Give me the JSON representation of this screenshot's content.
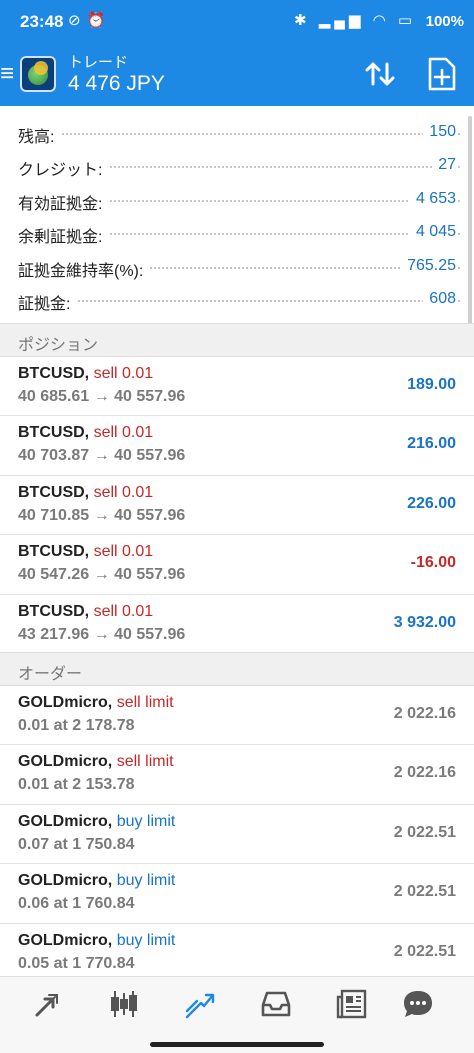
{
  "status_bar": {
    "time": "23:48",
    "battery": "100%"
  },
  "app_bar": {
    "title": "トレード",
    "subtitle": "4 476 JPY"
  },
  "summary": [
    {
      "label": "残高:",
      "value": "150"
    },
    {
      "label": "クレジット:",
      "value": "27"
    },
    {
      "label": "有効証拠金:",
      "value": "4 653"
    },
    {
      "label": "余剰証拠金:",
      "value": "4 045"
    },
    {
      "label": "証拠金維持率(%):",
      "value": "765.25"
    },
    {
      "label": "証拠金:",
      "value": "608"
    }
  ],
  "positions_header": "ポジション",
  "positions": [
    {
      "symbol": "BTCUSD,",
      "type": "sell 0.01",
      "prices": "40 685.61 → 40 557.96",
      "profit": "189.00"
    },
    {
      "symbol": "BTCUSD,",
      "type": "sell 0.01",
      "prices": "40 703.87 → 40 557.96",
      "profit": "216.00"
    },
    {
      "symbol": "BTCUSD,",
      "type": "sell 0.01",
      "prices": "40 710.85 → 40 557.96",
      "profit": "226.00"
    },
    {
      "symbol": "BTCUSD,",
      "type": "sell 0.01",
      "prices": "40 547.26 → 40 557.96",
      "profit": "-16.00"
    },
    {
      "symbol": "BTCUSD,",
      "type": "sell 0.01",
      "prices": "43 217.96 → 40 557.96",
      "profit": "3 932.00"
    }
  ],
  "orders_header": "オーダー",
  "orders": [
    {
      "symbol": "GOLDmicro,",
      "type": "sell limit",
      "detail": "0.01 at 2 178.78",
      "price": "2 022.16"
    },
    {
      "symbol": "GOLDmicro,",
      "type": "sell limit",
      "detail": "0.01 at 2 153.78",
      "price": "2 022.16"
    },
    {
      "symbol": "GOLDmicro,",
      "type": "buy limit",
      "detail": "0.07 at 1 750.84",
      "price": "2 022.51"
    },
    {
      "symbol": "GOLDmicro,",
      "type": "buy limit",
      "detail": "0.06 at 1 760.84",
      "price": "2 022.51"
    },
    {
      "symbol": "GOLDmicro,",
      "type": "buy limit",
      "detail": "0.05 at 1 770.84",
      "price": "2 022.51"
    }
  ],
  "bottom_nav": [
    {
      "icon": "quotes-icon",
      "active": false
    },
    {
      "icon": "chart-icon",
      "active": false
    },
    {
      "icon": "trade-icon",
      "active": true
    },
    {
      "icon": "history-icon",
      "active": false
    },
    {
      "icon": "news-icon",
      "active": false
    },
    {
      "icon": "messages-icon",
      "active": false
    }
  ],
  "colors": {
    "accent": "#1e88e5",
    "value_blue": "#1a73c9",
    "sell_red": "#c62828"
  }
}
